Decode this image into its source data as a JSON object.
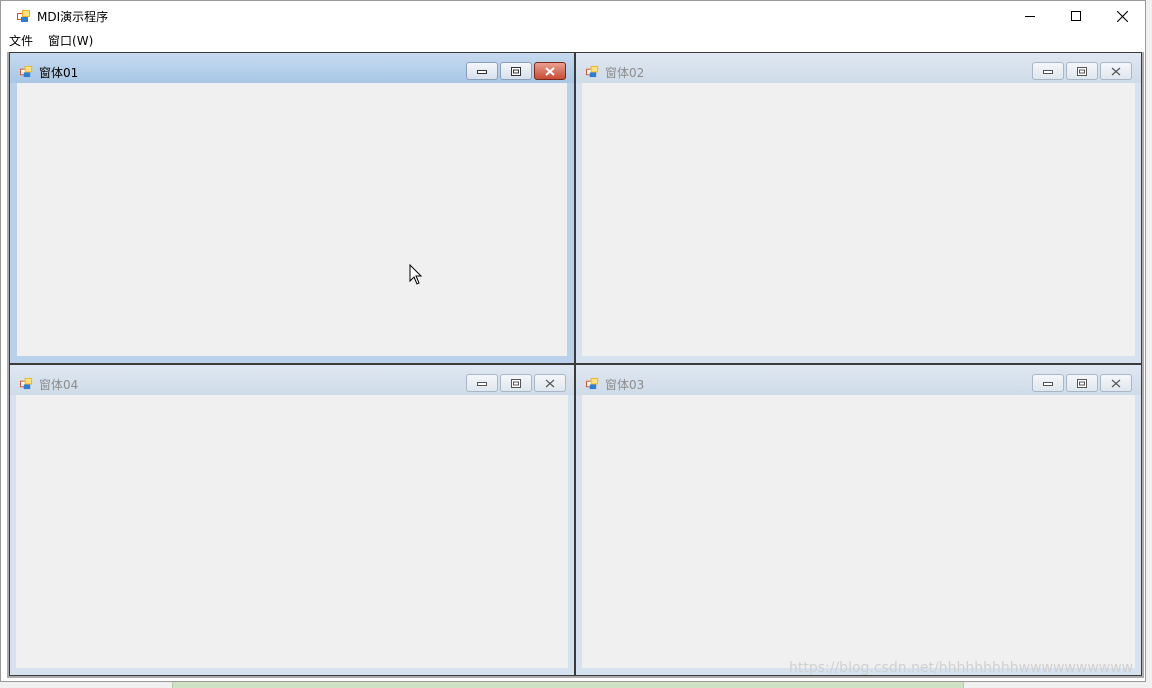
{
  "app": {
    "title": "MDI演示程序",
    "icon": "app-window-icon"
  },
  "window_controls": {
    "minimize": "minimize-icon",
    "maximize": "maximize-icon",
    "close": "close-icon"
  },
  "menu": {
    "items": [
      "文件",
      "窗口(W)"
    ]
  },
  "children": [
    {
      "title": "窗体01",
      "state": "active"
    },
    {
      "title": "窗体02",
      "state": "inactive"
    },
    {
      "title": "窗体04",
      "state": "inactive"
    },
    {
      "title": "窗体03",
      "state": "inactive"
    }
  ],
  "watermark": "https://blog.csdn.net/hhhhhhhhhwwwwwwwwww",
  "colors": {
    "active_caption": "#a9c7e6",
    "inactive_caption": "#dfe8f2",
    "close_active": "#c74c35",
    "mdi_background": "#ababab"
  }
}
